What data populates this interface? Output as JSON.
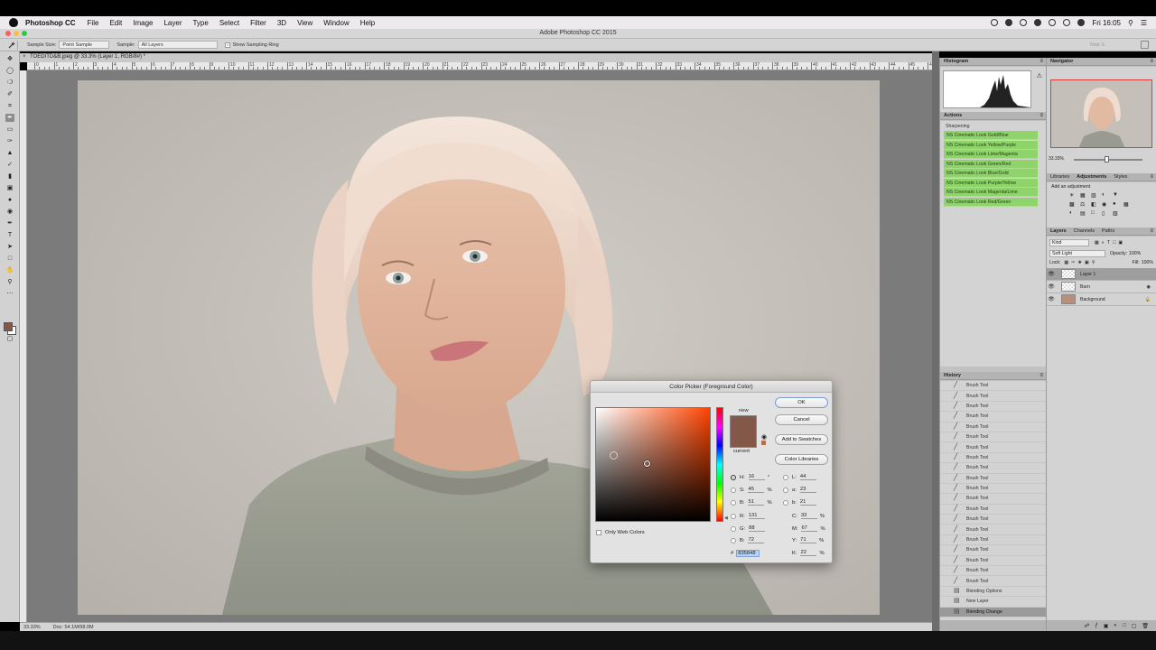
{
  "menubar": {
    "app": "Photoshop CC",
    "items": [
      "File",
      "Edit",
      "Image",
      "Layer",
      "Type",
      "Select",
      "Filter",
      "3D",
      "View",
      "Window",
      "Help"
    ],
    "clock": "Fri 16:05"
  },
  "window": {
    "title": "Adobe Photoshop CC 2015"
  },
  "options": {
    "sample_size_label": "Sample Size:",
    "sample_size_value": "Point Sample",
    "sample_label": "Sample:",
    "sample_value": "All Layers",
    "show_ring_label": "Show Sampling Ring",
    "right_label": "Matt S"
  },
  "document": {
    "tab_title": "TOEDITD&B.jpeg @ 33.3% (Layer 1, RGB/8#) *",
    "ruler_numbers": [
      "0",
      "1",
      "2",
      "3",
      "4",
      "5",
      "6",
      "7",
      "8",
      "9",
      "10",
      "11",
      "12",
      "13",
      "14",
      "15",
      "16",
      "17",
      "18",
      "19",
      "20",
      "21",
      "22",
      "23",
      "24",
      "25",
      "26",
      "27",
      "28",
      "29",
      "30",
      "31",
      "32",
      "33",
      "34",
      "35",
      "36",
      "37",
      "38",
      "39",
      "40",
      "41",
      "42",
      "43",
      "44",
      "45",
      "46",
      "47"
    ],
    "zoom": "33.33%",
    "doc_size": "Doc: 54.1M/98.0M"
  },
  "panels": {
    "histogram_title": "Histogram",
    "actions_title": "Actions",
    "actions_set": "Sharpening",
    "actions": [
      "NS Cinematic Look Gold/Blue",
      "NS Cinematic Look Yellow/Purple",
      "NS Cinematic Look Lime/Magenta",
      "NS Cinematic Look Green/Red",
      "NS Cinematic Look Blue/Gold",
      "NS Cinematic Look Purple/Yellow",
      "NS Cinematic Look Magenta/Lime",
      "NS Cinematic Look Red/Green"
    ],
    "history_title": "History",
    "history": [
      "Brush Tool",
      "Brush Tool",
      "Brush Tool",
      "Brush Tool",
      "Brush Tool",
      "Brush Tool",
      "Brush Tool",
      "Brush Tool",
      "Brush Tool",
      "Brush Tool",
      "Brush Tool",
      "Brush Tool",
      "Brush Tool",
      "Brush Tool",
      "Brush Tool",
      "Brush Tool",
      "Brush Tool",
      "Brush Tool",
      "Brush Tool",
      "Brush Tool",
      "Blending Options",
      "New Layer",
      "Blending Change"
    ],
    "navigator_title": "Navigator",
    "navigator_zoom": "33.33%",
    "adj_tabs": [
      "Libraries",
      "Adjustments",
      "Styles"
    ],
    "adj_hint": "Add an adjustment",
    "layers_tabs": [
      "Layers",
      "Channels",
      "Paths"
    ],
    "layers_kind": "Kind",
    "blend_mode": "Soft Light",
    "opacity_label": "Opacity:",
    "opacity_value": "100%",
    "lock_label": "Lock:",
    "fill_label": "Fill:",
    "fill_value": "100%",
    "layers": [
      "Layer 1",
      "Burn",
      "Background"
    ]
  },
  "picker": {
    "title": "Color Picker (Foreground Color)",
    "new_label": "new",
    "current_label": "current",
    "new_color": "#835848",
    "current_color": "#835848",
    "ok": "OK",
    "cancel": "Cancel",
    "add_swatches": "Add to Swatches",
    "color_libraries": "Color Libraries",
    "only_web": "Only Web Colors",
    "hsb": {
      "h_label": "H:",
      "h": "16",
      "h_unit": "°",
      "s_label": "S:",
      "s": "45",
      "s_unit": "%",
      "b_label": "B:",
      "b": "51",
      "b_unit": "%"
    },
    "rgb": {
      "r_label": "R:",
      "r": "131",
      "g_label": "G:",
      "g": "88",
      "bl_label": "B:",
      "bl": "72"
    },
    "lab": {
      "l_label": "L:",
      "l": "44",
      "a_label": "a:",
      "a": "23",
      "b_label": "b:",
      "b": "21"
    },
    "cmyk": {
      "c_label": "C:",
      "c": "33",
      "m_label": "M:",
      "m": "67",
      "y_label": "Y:",
      "y": "71",
      "k_label": "K:",
      "k": "22",
      "unit": "%"
    },
    "hex_label": "#",
    "hex": "835848"
  },
  "colors": {
    "foreground": "#835848",
    "action_green": "#8fd36b",
    "highlight": "#9a9a9a"
  }
}
